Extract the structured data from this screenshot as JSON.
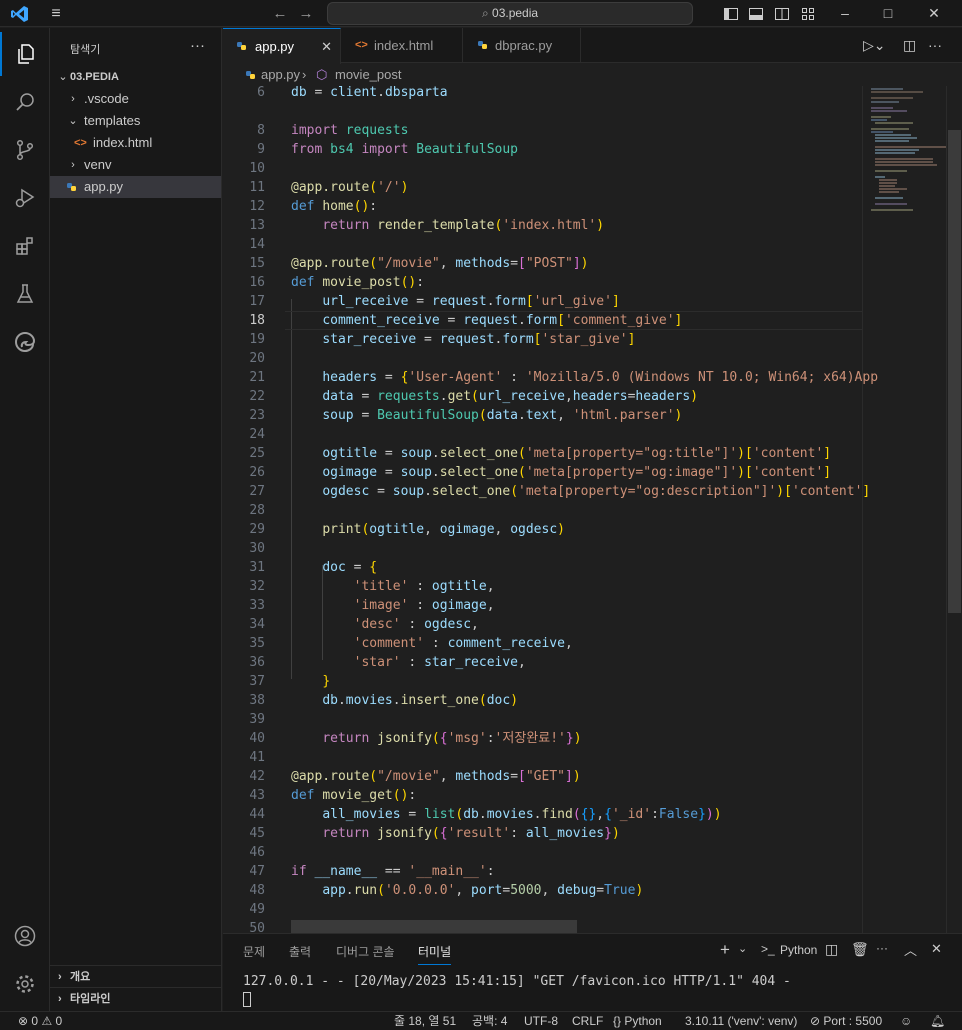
{
  "titlebar": {
    "search": "03.pedia",
    "minimize": "–",
    "maximize": "□",
    "close": "✕"
  },
  "sidebar": {
    "title": "탐색기",
    "more": "···",
    "root": "03.PEDIA",
    "items": [
      {
        "label": ".vscode"
      },
      {
        "label": "templates"
      },
      {
        "label": "index.html"
      },
      {
        "label": "venv"
      },
      {
        "label": "app.py"
      }
    ],
    "outline": "개요",
    "timeline": "타임라인"
  },
  "tabs": [
    {
      "label": "app.py"
    },
    {
      "label": "index.html"
    },
    {
      "label": "dbprac.py"
    }
  ],
  "breadcrumb": {
    "file": "app.py",
    "symbol": "movie_post"
  },
  "editor": {
    "current_line": 18,
    "lines": [
      "6",
      "8",
      "9",
      "10",
      "11",
      "12",
      "13",
      "14",
      "15",
      "16",
      "17",
      "18",
      "19",
      "20",
      "21",
      "22",
      "23",
      "24",
      "25",
      "26",
      "27",
      "28",
      "29",
      "30",
      "31",
      "32",
      "33",
      "34",
      "35",
      "36",
      "37",
      "38",
      "39",
      "40",
      "41",
      "42",
      "43",
      "44",
      "45",
      "46",
      "47",
      "48",
      "49",
      "50"
    ]
  },
  "panel": {
    "tabs": [
      "문제",
      "출력",
      "디버그 콘솔",
      "터미널"
    ],
    "active_tab": "터미널",
    "terminal_label": "Python",
    "output": "127.0.0.1 - - [20/May/2023 15:41:15] \"GET /favicon.ico HTTP/1.1\" 404 -"
  },
  "status": {
    "errors": "0",
    "warnings": "0",
    "position": "줄 18, 열 51",
    "spaces": "공백: 4",
    "encoding": "UTF-8",
    "eol": "CRLF",
    "language": "Python",
    "interpreter": "3.10.11 ('venv': venv)",
    "port": "Port : 5500"
  },
  "colors": {
    "accent": "#0078d4",
    "background": "#1f1f1f",
    "sidebar": "#181818"
  }
}
